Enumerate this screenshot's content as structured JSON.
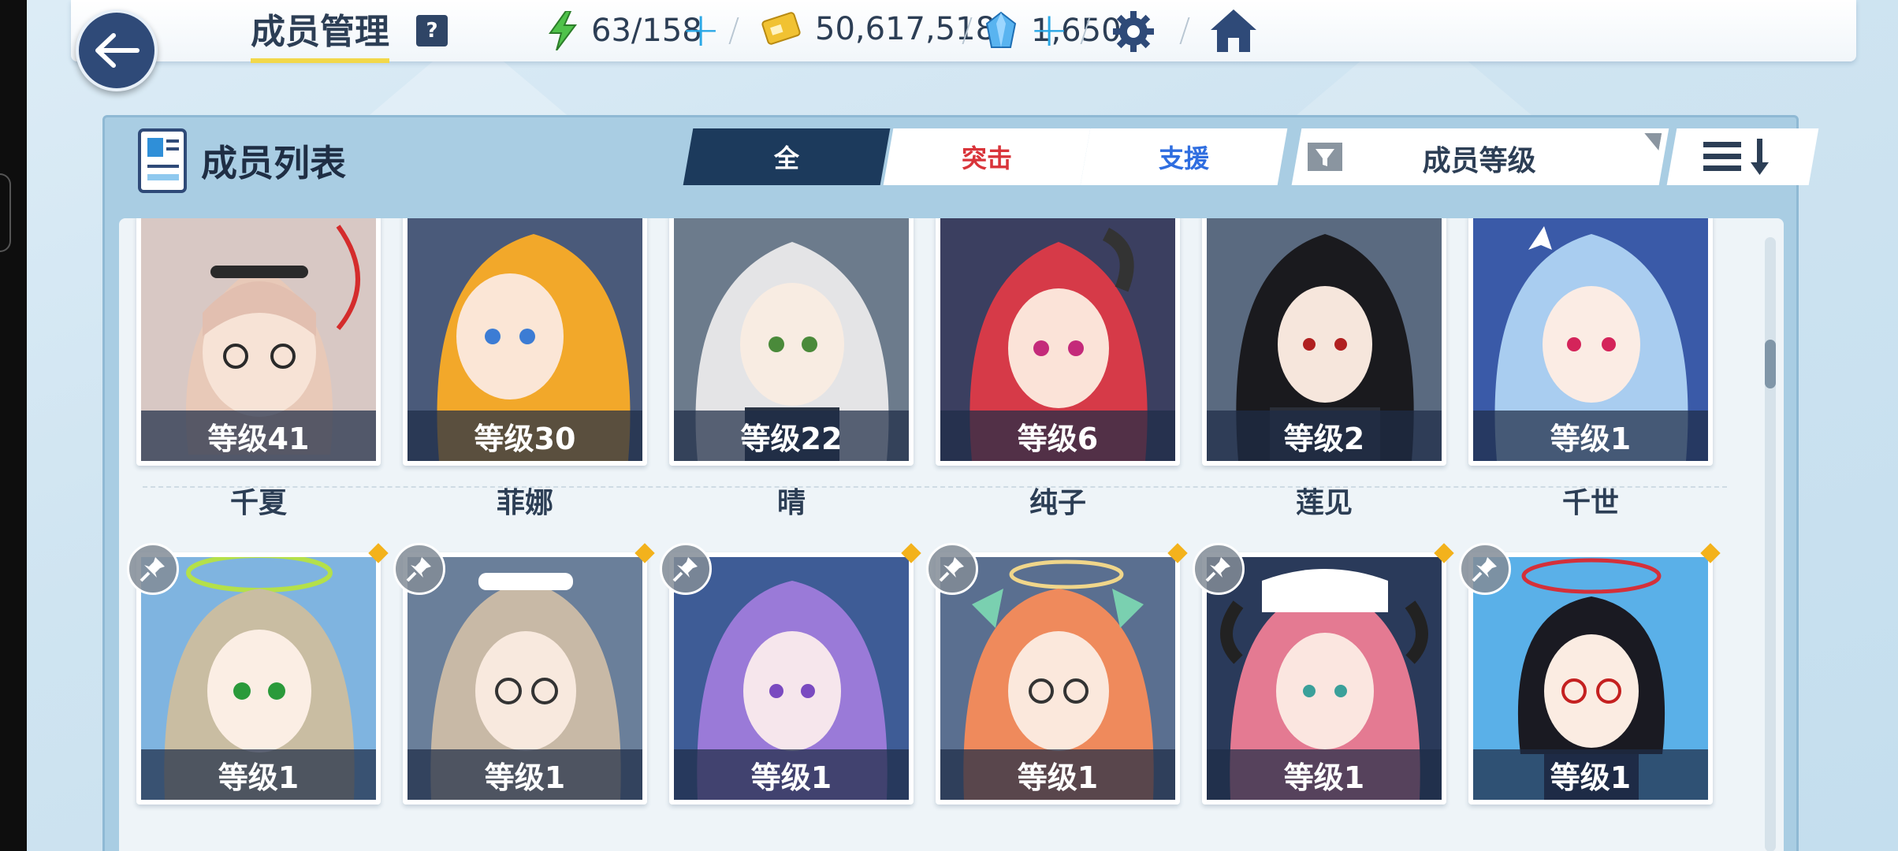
{
  "header": {
    "title": "成员管理",
    "help_label": "?",
    "stamina": "63/158",
    "credits": "50,617,518",
    "gems": "1,650",
    "plus_symbol": "+",
    "icons": {
      "back": "back-arrow-icon",
      "stamina": "lightning-icon",
      "credits": "credit-card-icon",
      "gems": "crystal-icon",
      "settings": "gear-icon",
      "home": "home-icon"
    }
  },
  "panel": {
    "title": "成员列表",
    "tabs": [
      {
        "label": "全",
        "active": true,
        "color": "#ffffff"
      },
      {
        "label": "突击",
        "active": false,
        "color": "#d9343a"
      },
      {
        "label": "支援",
        "active": false,
        "color": "#2f6ee0"
      }
    ],
    "sort_label": "成员等级"
  },
  "members_row1": [
    {
      "level": "等级41",
      "name": "千夏"
    },
    {
      "level": "等级30",
      "name": "菲娜"
    },
    {
      "level": "等级22",
      "name": "晴"
    },
    {
      "level": "等级6",
      "name": "纯子"
    },
    {
      "level": "等级2",
      "name": "莲见"
    },
    {
      "level": "等级1",
      "name": "千世"
    }
  ],
  "members_row2": [
    {
      "level": "等级1"
    },
    {
      "level": "等级1"
    },
    {
      "level": "等级1"
    },
    {
      "level": "等级1"
    },
    {
      "level": "等级1"
    },
    {
      "level": "等级1"
    }
  ],
  "colors": {
    "accent_dark": "#1c3a5c",
    "highlight_yellow": "#f2d84a",
    "plus_blue": "#2aa8e6",
    "pin_diamond": "#f3b21c"
  }
}
